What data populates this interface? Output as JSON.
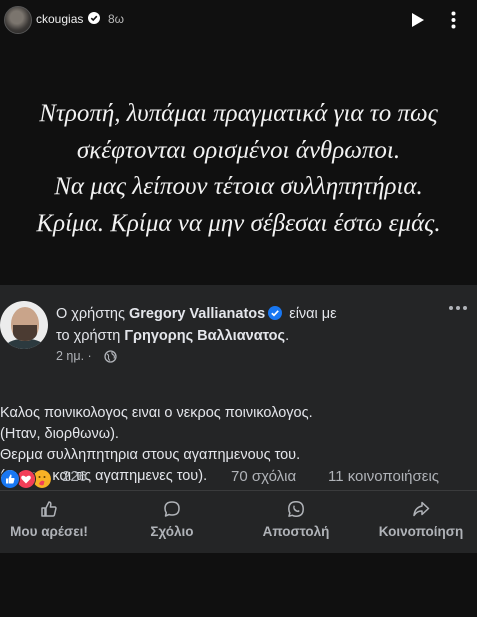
{
  "story": {
    "username": "ckougias",
    "time": "8ω",
    "text_lines": [
      "Ντροπή, λυπάμαι πραγματικά για το πως",
      "σκέφτονται ορισμένοι άνθρωποι.",
      "Να μας λείπουν τέτοια συλληπητήρια.",
      "Κρίμα. Κρίμα να μην σέβεσαι έστω εμάς."
    ]
  },
  "post": {
    "header_prefix": "Ο χρήστης ",
    "author": "Gregory Vallianatos",
    "header_middle": " είναι με",
    "header_line2_prefix": "το χρήστη ",
    "tagged": "Γρηγορης Βαλλιανατος",
    "header_suffix": ".",
    "time": "2 ημ. ·",
    "body_lines": [
      "Καλος ποινικολογος ειναι ο νεκρος ποινικολογος.",
      "(Ηταν, διορθωνω).",
      "Θερμα συλληπητηρια στους αγαπημενους του.",
      "(Εννοω και τις αγαπημενες του)."
    ],
    "reaction_count": "226",
    "comments": "70 σχόλια",
    "shares": "11 κοινοποιήσεις",
    "actions": {
      "like": "Μου αρέσει!",
      "comment": "Σχόλιο",
      "send": "Αποστολή",
      "share": "Κοινοποίηση"
    }
  },
  "colors": {
    "background": "#101010",
    "card": "#242526",
    "verified": "#1877f2",
    "muted": "#b0b3b8"
  },
  "icons": [
    "verified-icon",
    "play-icon",
    "more-icon",
    "globe-icon",
    "like-reaction-icon",
    "love-reaction-icon",
    "care-reaction-icon",
    "thumbs-up-icon",
    "comment-icon",
    "whatsapp-icon",
    "share-icon"
  ]
}
